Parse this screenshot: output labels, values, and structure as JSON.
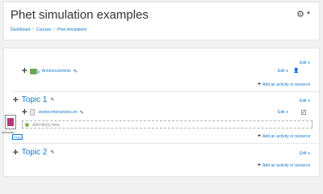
{
  "header": {
    "title": "Phet simulation examples",
    "gear_icon": "gear-icon",
    "breadcrumb": [
      "Dashboard",
      "Courses",
      "Phet simulations"
    ]
  },
  "edit_label": "Edit",
  "add_activity_label": "Add an activity or resource",
  "general_section": {
    "announcements_label": "Announcements"
  },
  "topic1": {
    "title": "Topic 1",
    "activity_name": "atome-interactions.en",
    "dropzone_label": "Add file(s) here"
  },
  "topic2": {
    "title": "Topic 2"
  },
  "drag": {
    "file_name": "yellowdisc",
    "copy_label": "Copy"
  }
}
